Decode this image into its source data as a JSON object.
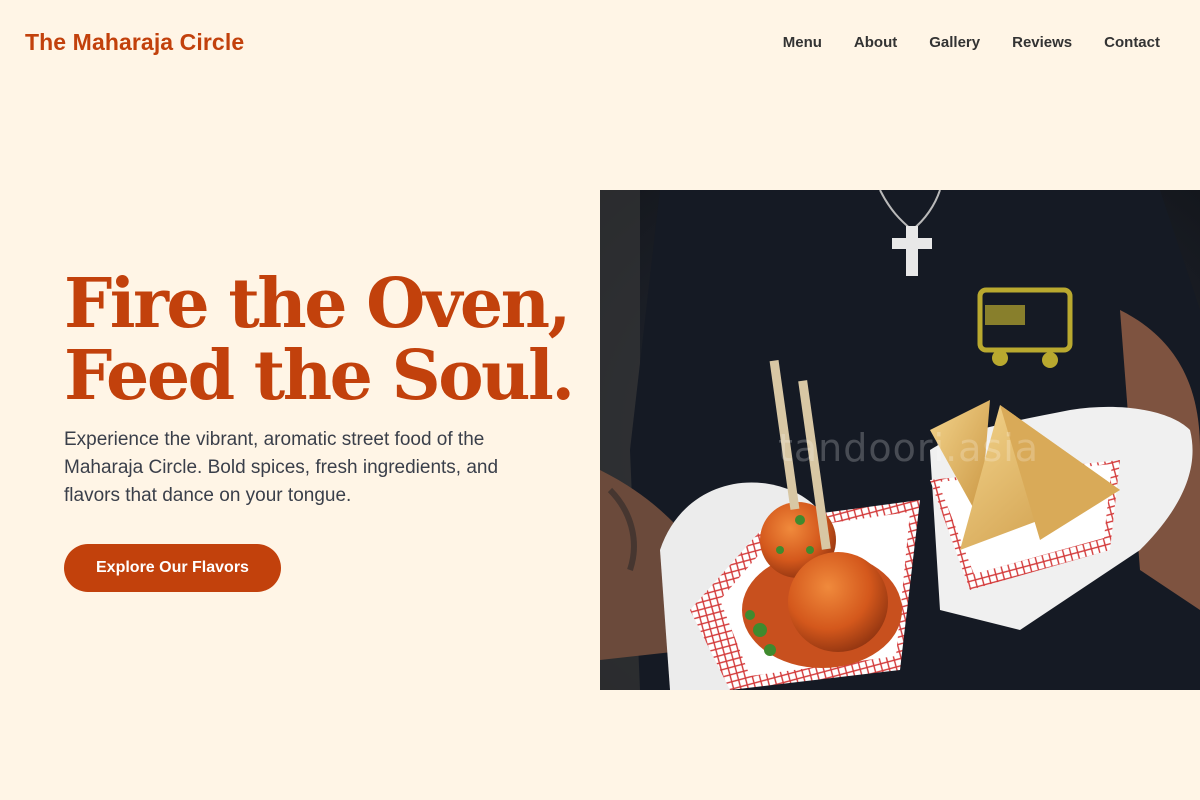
{
  "header": {
    "brand": "The Maharaja Circle",
    "nav": [
      {
        "label": "Menu"
      },
      {
        "label": "About"
      },
      {
        "label": "Gallery"
      },
      {
        "label": "Reviews"
      },
      {
        "label": "Contact"
      }
    ]
  },
  "hero": {
    "headline_line1": "Fire the Oven,",
    "headline_line2": "Feed the Soul.",
    "subtext": "Experience the vibrant, aromatic street food of the Maharaja Circle. Bold spices, fresh ingredients, and flavors that dance on your tongue.",
    "cta_label": "Explore Our Flavors",
    "image_watermark": "tandoori.asia"
  },
  "colors": {
    "background": "#fff5e6",
    "accent": "#c2410c",
    "text": "#3a3f4a"
  }
}
